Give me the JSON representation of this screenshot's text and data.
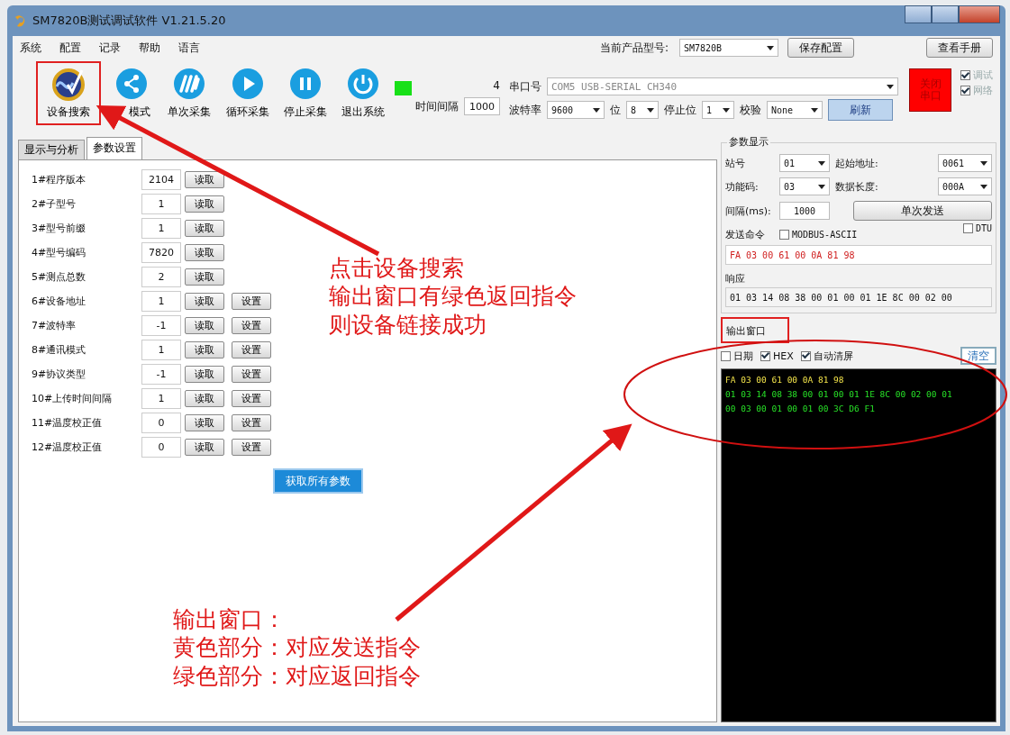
{
  "window": {
    "title": "SM7820B测试调试软件  V1.21.5.20"
  },
  "menu": [
    "系统",
    "配置",
    "记录",
    "帮助",
    "语言"
  ],
  "product": {
    "label": "当前产品型号:",
    "value": "SM7820B"
  },
  "header_buttons": [
    "保存配置",
    "查看手册"
  ],
  "toolbar": [
    {
      "label": "设备搜索",
      "kind": "search",
      "highlighted": true
    },
    {
      "label": "模式",
      "kind": "mode",
      "highlighted": false
    },
    {
      "label": "单次采集",
      "kind": "single",
      "highlighted": false
    },
    {
      "label": "循环采集",
      "kind": "loop",
      "highlighted": false
    },
    {
      "label": "停止采集",
      "kind": "stop",
      "highlighted": false
    },
    {
      "label": "退出系统",
      "kind": "exit",
      "highlighted": false
    }
  ],
  "connection": {
    "on": true,
    "count": "4",
    "interval_label": "时间间隔",
    "interval": "1000"
  },
  "serial": {
    "port_label": "串口号",
    "port": "COM5 USB-SERIAL CH340",
    "baud_label": "波特率",
    "baud": "9600",
    "bits_label": "位",
    "bits": "8",
    "stop_label": "停止位",
    "stop": "1",
    "parity_label": "校验",
    "parity": "None",
    "refresh": "刷新",
    "close_port": "关闭串口"
  },
  "options": [
    {
      "label": "调试",
      "checked": true
    },
    {
      "label": "网络",
      "checked": true
    }
  ],
  "tabs": [
    {
      "label": "显示与分析",
      "selected": false
    },
    {
      "label": "参数设置",
      "selected": true
    }
  ],
  "params": [
    {
      "label": "1#程序版本",
      "value": "2104",
      "read": "读取"
    },
    {
      "label": "2#子型号",
      "value": "1",
      "read": "读取"
    },
    {
      "label": "3#型号前缀",
      "value": "1",
      "read": "读取"
    },
    {
      "label": "4#型号编码",
      "value": "7820",
      "read": "读取"
    },
    {
      "label": "5#测点总数",
      "value": "2",
      "read": "读取"
    },
    {
      "label": "6#设备地址",
      "value": "1",
      "read": "读取",
      "set": "设置"
    },
    {
      "label": "7#波特率",
      "value": "-1",
      "read": "读取",
      "set": "设置"
    },
    {
      "label": "8#通讯模式",
      "value": "1",
      "read": "读取",
      "set": "设置"
    },
    {
      "label": "9#协议类型",
      "value": "-1",
      "read": "读取",
      "set": "设置"
    },
    {
      "label": "10#上传时间间隔",
      "value": "1",
      "read": "读取",
      "set": "设置"
    },
    {
      "label": "11#温度校正值",
      "value": "0",
      "read": "读取",
      "set": "设置"
    },
    {
      "label": "12#温度校正值",
      "value": "0",
      "read": "读取",
      "set": "设置"
    }
  ],
  "get_all_button": "获取所有参数",
  "param_display": {
    "title": "参数显示",
    "station": {
      "label": "站号",
      "value": "01"
    },
    "start_address": {
      "label": "起始地址:",
      "value": "0061"
    },
    "function_code": {
      "label": "功能码:",
      "value": "03"
    },
    "data_length": {
      "label": "数据长度:",
      "value": "000A"
    },
    "interval": {
      "label": "间隔(ms):",
      "value": "1000"
    },
    "send_button": "单次发送",
    "dtu": {
      "label": "DTU",
      "checked": false
    },
    "send_label": "发送命令",
    "modbus_ascii": {
      "label": "MODBUS-ASCII",
      "checked": false
    },
    "send_value": "FA 03 00 61 00 0A 81 98",
    "response_label": "响应",
    "response_value": "01 03 14 08 38 00 01 00 01 1E 8C 00 02 00"
  },
  "output": {
    "title": "输出窗口",
    "highlighted": true,
    "options": [
      {
        "label": "日期",
        "checked": false
      },
      {
        "label": "HEX",
        "checked": true
      },
      {
        "label": "自动清屏",
        "checked": true
      }
    ],
    "clear_button": "清空",
    "lines": [
      {
        "text": "FA 03 00 61 00 0A 81 98",
        "kind": "sent"
      },
      {
        "text": "01 03 14 08 38 00 01 00 01 1E 8C 00 02 00 01",
        "kind": "received"
      },
      {
        "text": "00 03 00 01 00 01 00 3C D6 F1",
        "kind": "received"
      }
    ]
  },
  "annotations": {
    "search_note": [
      "点击设备搜索",
      "输出窗口有绿色返回指令",
      "则设备链接成功"
    ],
    "output_note": [
      "输出窗口：",
      "黄色部分：对应发送指令",
      "绿色部分：对应返回指令"
    ]
  }
}
